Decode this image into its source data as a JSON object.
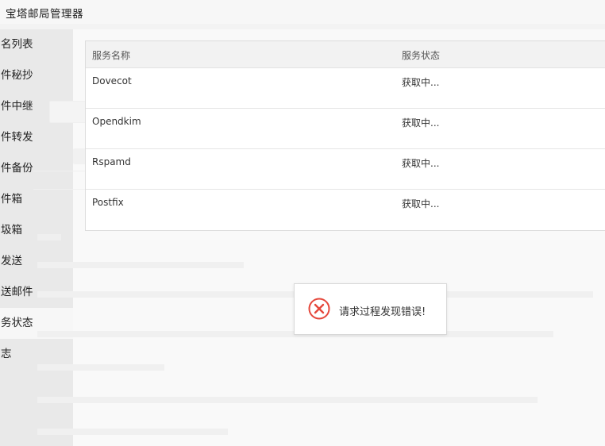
{
  "app": {
    "title": "宝塔邮局管理器"
  },
  "sidebar": {
    "items": [
      {
        "label": "名列表"
      },
      {
        "label": "件秘抄"
      },
      {
        "label": "件中继"
      },
      {
        "label": "件转发"
      },
      {
        "label": "件备份"
      },
      {
        "label": "件箱"
      },
      {
        "label": "圾箱"
      },
      {
        "label": "发送"
      },
      {
        "label": "送邮件"
      },
      {
        "label": "务状态",
        "active": true
      },
      {
        "label": "志"
      }
    ]
  },
  "services_table": {
    "headers": [
      "服务名称",
      "服务状态"
    ],
    "rows": [
      {
        "name": "Dovecot",
        "status": "获取中..."
      },
      {
        "name": "Opendkim",
        "status": "获取中..."
      },
      {
        "name": "Rspamd",
        "status": "获取中..."
      },
      {
        "name": "Postfix",
        "status": "获取中..."
      }
    ]
  },
  "toast": {
    "message": "请求过程发现错误!",
    "icon": "error-circle-x-icon",
    "color": "#e5473b"
  }
}
